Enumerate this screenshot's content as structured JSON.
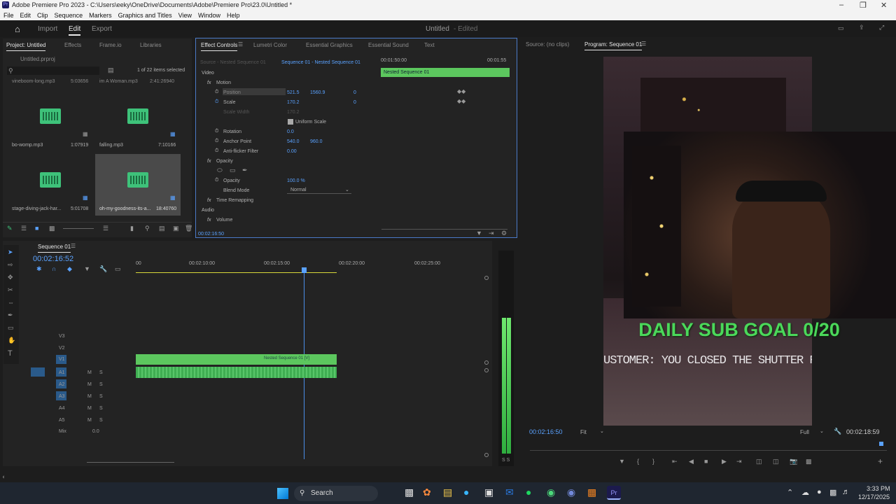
{
  "window": {
    "title": "Adobe Premiere Pro 2023 - C:\\Users\\eeky\\OneDrive\\Documents\\Adobe\\Premiere Pro\\23.0\\Untitled *",
    "logo": "Pr"
  },
  "menu": [
    "File",
    "Edit",
    "Clip",
    "Sequence",
    "Markers",
    "Graphics and Titles",
    "View",
    "Window",
    "Help"
  ],
  "workspace": {
    "home_icon": "home-icon",
    "import": "Import",
    "edit": "Edit",
    "export": "Export",
    "project_name": "Untitled",
    "status": "- Edited"
  },
  "project": {
    "tab_project": "Project: Untitled",
    "tab_effects": "Effects",
    "tab_frameio": "Frame.io",
    "tab_libraries": "Libraries",
    "file": "Untitled.prproj",
    "count": "1 of 22 items selected",
    "items": [
      {
        "name": "vineboom-long.mp3",
        "dur": "5:03656"
      },
      {
        "name": "im A Woman.mp3",
        "dur": "2:41:26940"
      },
      {
        "name": "bo-womp.mp3",
        "dur": "1:07919"
      },
      {
        "name": "falling.mp3",
        "dur": "7:10166"
      },
      {
        "name": "stage-diving-jack-har...",
        "dur": "5:01708"
      },
      {
        "name": "oh-my-goodness-its-a...",
        "dur": "18:40760"
      }
    ]
  },
  "effect_controls": {
    "tab_ec": "Effect Controls",
    "tab_lumetri": "Lumetri Color",
    "tab_eg": "Essential Graphics",
    "tab_es": "Essential Sound",
    "tab_text": "Text",
    "source": "Source - Nested Sequence 01",
    "sequence": "Sequence 01 - Nested Sequence 01",
    "time_a": "00:01:50:00",
    "time_b": "00:01:55",
    "clip_bar": "Nested Sequence 01",
    "video": "Video",
    "motion": "Motion",
    "position": "Position",
    "pos_x": "521.5",
    "pos_y": "1560.9",
    "scale": "Scale",
    "scale_v": "170.2",
    "scale_width": "Scale Width",
    "scale_width_v": "170.2",
    "uniform": "Uniform Scale",
    "rotation": "Rotation",
    "rotation_v": "0.0",
    "anchor": "Anchor Point",
    "anchor_x": "540.0",
    "anchor_y": "960.0",
    "antiflicker": "Anti-flicker Filter",
    "antiflicker_v": "0.00",
    "opacity_group": "Opacity",
    "opacity": "Opacity",
    "opacity_v": "100.0 %",
    "blend": "Blend Mode",
    "blend_v": "Normal",
    "remap": "Time Remapping",
    "audio": "Audio",
    "volume": "Volume",
    "timecode": "00:02:16:50",
    "zero": "0"
  },
  "monitors": {
    "source": "Source: (no clips)",
    "program": "Program: Sequence 01",
    "timecode": "00:02:16:50",
    "fit": "Fit",
    "full": "Full",
    "duration": "00:02:18:59",
    "overlay_goal": "DAILY SUB GOAL 0/20",
    "overlay_caption": "USTOMER: YOU CLOSED THE SHUTTER RIGHT IN MY F"
  },
  "timeline": {
    "tab": "Sequence 01",
    "timecode": "00:02:16:52",
    "ruler": [
      "00",
      "00:02:10:00",
      "00:02:15:00",
      "00:02:20:00",
      "00:02:25:00"
    ],
    "tracks": [
      "V3",
      "V2",
      "V1",
      "A1",
      "A2",
      "A3",
      "A4",
      "A5"
    ],
    "mix": "Mix",
    "mix_v": "0.0",
    "clip": "Nested Sequence 01 [V]",
    "meter": "S S",
    "m": "M",
    "s": "S"
  },
  "taskbar": {
    "search": "Search",
    "time": "3:33 PM",
    "date": "12/17/2025"
  },
  "colors": {
    "accent": "#5aa2ff",
    "clip_green": "#5cc75e",
    "goal_green": "#4bd85a"
  }
}
